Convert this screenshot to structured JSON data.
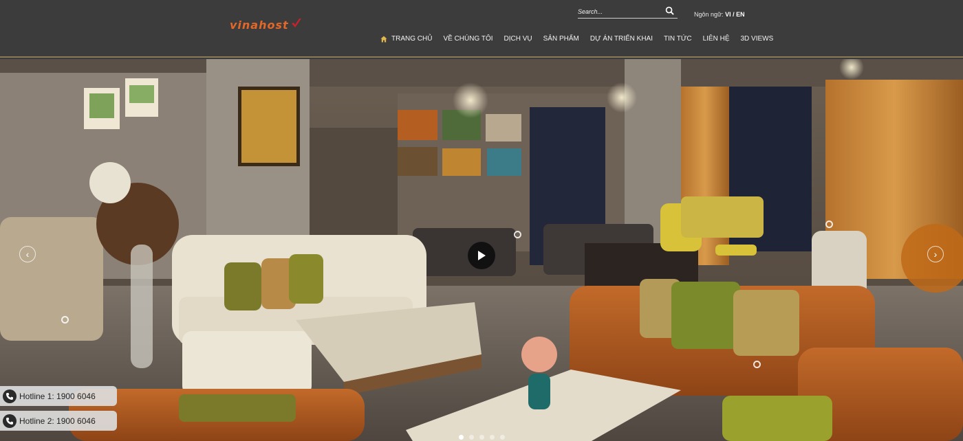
{
  "header": {
    "logo_text": "vinahost",
    "search_placeholder": "Search...",
    "language_label": "Ngôn ngữ:",
    "language_value": "VI / EN"
  },
  "nav": {
    "items": [
      {
        "label": "TRANG CHỦ",
        "icon": "home-icon"
      },
      {
        "label": "VỀ CHÚNG TÔI"
      },
      {
        "label": "DỊCH VỤ"
      },
      {
        "label": "SẢN PHẨM"
      },
      {
        "label": "DỰ ÁN TRIỂN KHAI"
      },
      {
        "label": "TIN TỨC"
      },
      {
        "label": "LIÊN HỆ"
      },
      {
        "label": "3D VIEWS"
      }
    ]
  },
  "hero": {
    "left_arrow": "‹",
    "right_arrow": "›",
    "slides_count": 5,
    "active_slide": 1
  },
  "hotlines": [
    {
      "label": "Hotline 1: 1900 6046"
    },
    {
      "label": "Hotline 2: 1900 6046"
    }
  ],
  "colors": {
    "header_bg": "#3c3c3c",
    "logo_orange": "#e2682a",
    "logo_red": "#c4232b"
  }
}
